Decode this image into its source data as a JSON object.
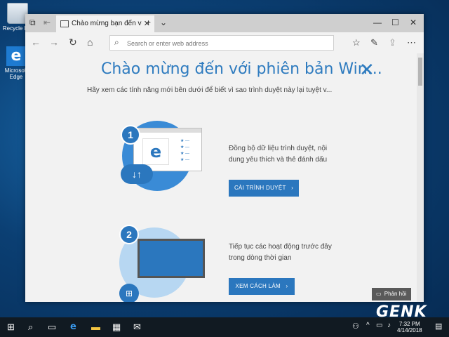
{
  "desktop": {
    "icons": [
      {
        "label": "Recycle Bin"
      },
      {
        "label": "Microsoft Edge"
      }
    ]
  },
  "browser": {
    "tab_title": "Chào mừng bạn đến với",
    "address_placeholder": "Search or enter web address"
  },
  "page": {
    "headline": "Chào mừng đến với phiên bản Win...",
    "subheadline": "Hãy xem các tính năng mới bên dưới để biết vì sao trình duyệt này lại tuyệt v...",
    "features": [
      {
        "number": "1",
        "description_line1": "Đồng bộ dữ liệu trình duyệt, nội",
        "description_line2": "dung yêu thích và thẻ đánh dấu",
        "button": "CÀI TRÌNH DUYỆT"
      },
      {
        "number": "2",
        "description_line1": "Tiếp tục các hoạt động trước đây",
        "description_line2": "trong dòng thời gian",
        "button": "XEM CÁCH LÀM"
      }
    ],
    "feedback_button": "Phản hồi"
  },
  "taskbar": {
    "time": "7:32 PM",
    "date": "4/14/2018"
  },
  "watermark": "GENK",
  "colors": {
    "accent": "#2b77be",
    "taskbar": "#111a22"
  }
}
